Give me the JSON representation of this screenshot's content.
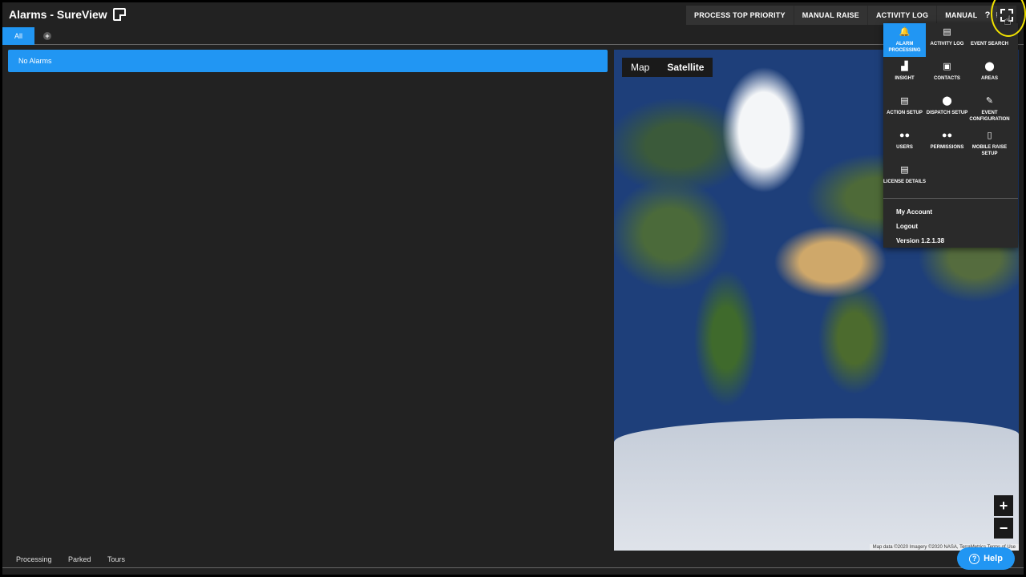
{
  "window": {
    "title": "Alarms - SureView"
  },
  "toolbar": {
    "buttons": [
      "PROCESS TOP PRIORITY",
      "MANUAL RAISE",
      "ACTIVITY LOG",
      "MANUAL TOUR"
    ],
    "help": "?"
  },
  "tabs": {
    "all": "All",
    "add": "+"
  },
  "alarms": {
    "empty_text": "No Alarms"
  },
  "map": {
    "type_buttons": [
      "Map",
      "Satellite"
    ],
    "zoom_in": "+",
    "zoom_out": "−",
    "attribution": "Map data ©2020 Imagery ©2020 NASA, TerraMetrics   Terms of Use"
  },
  "menu": {
    "items": [
      {
        "label": "ALARM PROCESSING",
        "icon": "bell-icon",
        "glyph": "🔔",
        "active": true
      },
      {
        "label": "ACTIVITY LOG",
        "icon": "list-icon",
        "glyph": "▤",
        "active": false
      },
      {
        "label": "EVENT SEARCH",
        "icon": "search-icon",
        "glyph": "",
        "active": false
      },
      {
        "label": "INSIGHT",
        "icon": "chart-icon",
        "glyph": "▟",
        "active": false
      },
      {
        "label": "CONTACTS",
        "icon": "contacts-icon",
        "glyph": "▣",
        "active": false
      },
      {
        "label": "AREAS",
        "icon": "map-pin-icon",
        "glyph": "⬤",
        "active": false
      },
      {
        "label": "ACTION SETUP",
        "icon": "clipboard-icon",
        "glyph": "▤",
        "active": false
      },
      {
        "label": "DISPATCH SETUP",
        "icon": "map-pin-icon",
        "glyph": "⬤",
        "active": false
      },
      {
        "label": "EVENT CONFIGURATION",
        "icon": "tools-icon",
        "glyph": "✎",
        "active": false
      },
      {
        "label": "USERS",
        "icon": "users-icon",
        "glyph": "●●",
        "active": false
      },
      {
        "label": "PERMISSIONS",
        "icon": "users-gear-icon",
        "glyph": "●●",
        "active": false
      },
      {
        "label": "MOBILE RAISE SETUP",
        "icon": "mobile-icon",
        "glyph": "▯",
        "active": false
      },
      {
        "label": "LICENSE DETAILS",
        "icon": "clipboard-check-icon",
        "glyph": "▤",
        "active": false
      }
    ],
    "links": [
      "My Account",
      "Logout",
      "Version 1.2.1.38"
    ]
  },
  "bottom_tabs": [
    "Processing",
    "Parked",
    "Tours"
  ],
  "help_button": {
    "label": "Help",
    "glyph": "?"
  },
  "colors": {
    "accent": "#2196f3",
    "background": "#222222",
    "highlight_ring": "#f1e200"
  }
}
